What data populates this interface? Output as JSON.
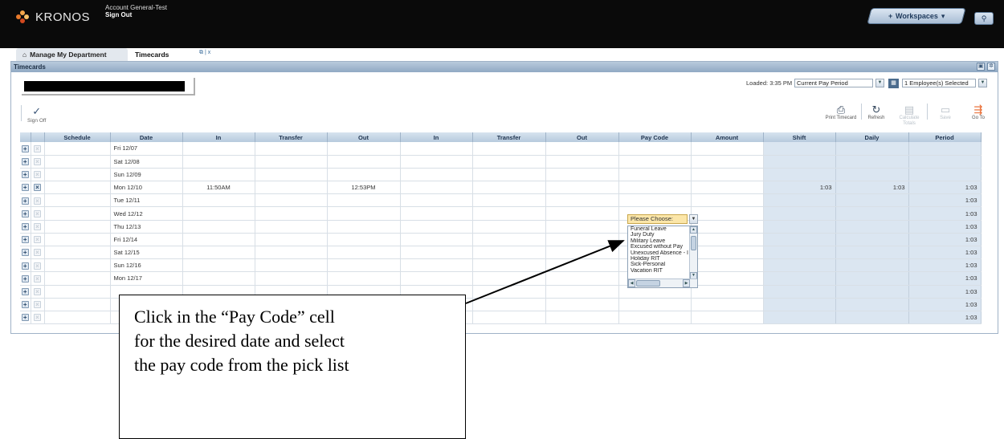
{
  "header": {
    "logo_text": "KRONOS",
    "account_name": "Account General-Test",
    "sign_out": "Sign Out",
    "workspaces_label": "Workspaces",
    "search_icon": "search-icon"
  },
  "tabs": [
    {
      "label": "Manage My Department",
      "icon": "home-icon"
    },
    {
      "label": "Timecards"
    }
  ],
  "tab_tools": "⧉ | x",
  "panel": {
    "title": "Timecards",
    "loaded_label": "Loaded: 3:35 PM",
    "period_select": "Current Pay Period",
    "employee_select": "1 Employee(s) Selected",
    "signoff_label": "Sign Off"
  },
  "toolbar": {
    "print": "Print Timecard",
    "refresh": "Refresh",
    "calculate": "Calculate Totals",
    "save": "Save",
    "goto": "Go To"
  },
  "grid": {
    "columns": [
      "Schedule",
      "Date",
      "In",
      "Transfer",
      "Out",
      "In",
      "Transfer",
      "Out",
      "Pay Code",
      "Amount",
      "Shift",
      "Daily",
      "Period"
    ],
    "rows": [
      {
        "date": "Fri 12/07",
        "in": "",
        "out": "",
        "shift": "",
        "daily": "",
        "period": ""
      },
      {
        "date": "Sat 12/08",
        "in": "",
        "out": "",
        "shift": "",
        "daily": "",
        "period": ""
      },
      {
        "date": "Sun 12/09",
        "in": "",
        "out": "",
        "shift": "",
        "daily": "",
        "period": ""
      },
      {
        "date": "Mon 12/10",
        "in": "11:50AM",
        "out": "12:53PM",
        "shift": "1:03",
        "daily": "1:03",
        "period": "1:03"
      },
      {
        "date": "Tue 12/11",
        "in": "",
        "out": "",
        "shift": "",
        "daily": "",
        "period": "1:03"
      },
      {
        "date": "Wed 12/12",
        "in": "",
        "out": "",
        "shift": "",
        "daily": "",
        "period": "1:03"
      },
      {
        "date": "Thu 12/13",
        "in": "",
        "out": "",
        "shift": "",
        "daily": "",
        "period": "1:03"
      },
      {
        "date": "Fri 12/14",
        "in": "",
        "out": "",
        "shift": "",
        "daily": "",
        "period": "1:03"
      },
      {
        "date": "Sat 12/15",
        "in": "",
        "out": "",
        "shift": "",
        "daily": "",
        "period": "1:03"
      },
      {
        "date": "Sun 12/16",
        "in": "",
        "out": "",
        "shift": "",
        "daily": "",
        "period": "1:03"
      },
      {
        "date": "Mon 12/17",
        "in": "",
        "out": "",
        "shift": "",
        "daily": "",
        "period": "1:03"
      },
      {
        "date": "",
        "in": "",
        "out": "",
        "shift": "",
        "daily": "",
        "period": "1:03"
      },
      {
        "date": "",
        "in": "",
        "out": "",
        "shift": "",
        "daily": "",
        "period": "1:03"
      },
      {
        "date": "",
        "in": "",
        "out": "",
        "shift": "",
        "daily": "",
        "period": "1:03"
      }
    ]
  },
  "paycode_dropdown": {
    "selected": "Please Choose:",
    "options": [
      "Funeral Leave",
      "Jury Duty",
      "Military Leave",
      "Excused without Pay",
      "Unexcused Absence - I",
      "Holiday RIT",
      "Sick-Personal",
      "Vacation RIT"
    ]
  },
  "callout": {
    "line1": "Click in the “Pay Code” cell",
    "line2": "for the desired date and select",
    "line3": "the pay code from the pick list"
  }
}
